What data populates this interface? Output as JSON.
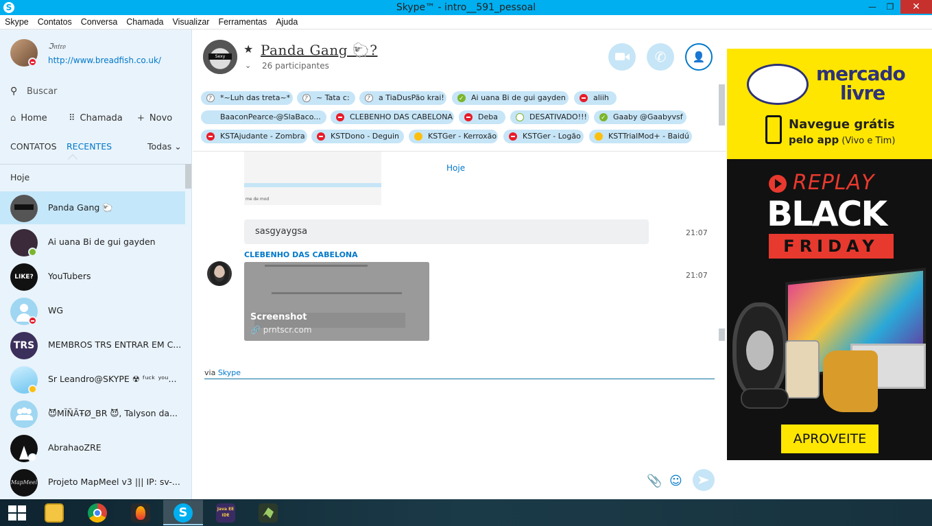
{
  "window": {
    "title": "Skype™ - intro__591_pessoal",
    "minimize": "—",
    "maximize": "❐",
    "close": "✕"
  },
  "menu": [
    "Skype",
    "Contatos",
    "Conversa",
    "Chamada",
    "Visualizar",
    "Ferramentas",
    "Ajuda"
  ],
  "profile": {
    "name": "ℑ𝔫𝔱𝔯𝔬",
    "mood": "http://www.breadfish.co.uk/"
  },
  "search": {
    "placeholder": "Buscar"
  },
  "nav": {
    "home": "Home",
    "call": "Chamada",
    "new": "Novo"
  },
  "tabs": {
    "contacts": "CONTATOS",
    "recent": "RECENTES",
    "filter": "Todas"
  },
  "section_today": "Hoje",
  "contacts": [
    {
      "name": "Panda Gang 🐑",
      "status": "none",
      "selected": true,
      "avatar_color": "#555"
    },
    {
      "name": "Ai uana Bi de gui gayden",
      "status": "online",
      "avatar_color": "#3a2a3a"
    },
    {
      "name": "YouTubers",
      "status": "none",
      "avatar_color": "#111",
      "avatar_text": "LIKE? xD"
    },
    {
      "name": "WG",
      "status": "busy",
      "avatar_color": "#9fd6f2"
    },
    {
      "name": "MEMBROS TRS ENTRAR EM C...",
      "status": "none",
      "avatar_color": "#3b2f5c",
      "avatar_text": "TRS"
    },
    {
      "name": "Sr Leandro@SKYPE ☢  ᶠᵘᶜᵏ ʸᵒᵘ...",
      "status": "away",
      "avatar_color": "#9fd6f2"
    },
    {
      "name": "😈MĨÑÃŦØ_BR 😈, Talyson da...",
      "status": "none",
      "avatar_color": "#9fd6f2"
    },
    {
      "name": "AbrahaoZRE",
      "status": "offline",
      "avatar_color": "#111"
    },
    {
      "name": "Projeto MapMeel v3 ||| IP: sv-...",
      "status": "none",
      "avatar_color": "#111",
      "avatar_text": "MapMeel"
    }
  ],
  "conversation": {
    "title": "Panda Gang 🐑?",
    "participants": "26 participantes",
    "avatar_label": "Sexy"
  },
  "participants": [
    {
      "name": "*~Luh das treta~*",
      "status": "q"
    },
    {
      "name": "~ Tata c:",
      "status": "q"
    },
    {
      "name": "a TiaDusPão krai!",
      "status": "q"
    },
    {
      "name": "Ai uana Bi de gui gayden",
      "status": "online"
    },
    {
      "name": "aliih",
      "status": "busy"
    },
    {
      "name": "BaaconPearce-@SlaBaco...",
      "status": "none"
    },
    {
      "name": "CLEBENHO DAS CABELONA",
      "status": "busy"
    },
    {
      "name": "Deba",
      "status": "busy"
    },
    {
      "name": "DESATIVADO!!!",
      "status": "offline"
    },
    {
      "name": "Gaaby @Gaabyvsf",
      "status": "online"
    },
    {
      "name": "KSTAjudante - Zombra",
      "status": "busy"
    },
    {
      "name": "KSTDono - Deguin",
      "status": "busy"
    },
    {
      "name": "KSTGer - Kerroxão",
      "status": "away"
    },
    {
      "name": "KSTGer - Logão",
      "status": "busy"
    },
    {
      "name": "KSTTrialMod+ - Baidú",
      "status": "away"
    }
  ],
  "messages": {
    "day": "Hoje",
    "partial_caption": "me de mod",
    "msg1": {
      "text": "sasgyaygsa",
      "time": "21:07"
    },
    "msg2": {
      "sender": "CLEBENHO DAS CABELONA",
      "time": "21:07",
      "preview_title": "Screenshot",
      "preview_link": "prntscr.com"
    }
  },
  "composer": {
    "via_prefix": "via ",
    "via_link": "Skype"
  },
  "ad": {
    "brand_line1": "mercado",
    "brand_line2": "livre",
    "cta_line1": "Navegue grátis",
    "cta_line2_bold": "pelo app",
    "cta_line2_rest": " (Vivo e Tim)",
    "replay": "REPLAY",
    "black": "BLACK",
    "friday": "FRIDAY",
    "button": "APROVEITE"
  },
  "taskbar": {
    "apps": [
      "file-explorer",
      "chrome",
      "flame-app",
      "skype",
      "java-ee-ide",
      "other-app"
    ],
    "java_label": "Java EE IDE"
  }
}
